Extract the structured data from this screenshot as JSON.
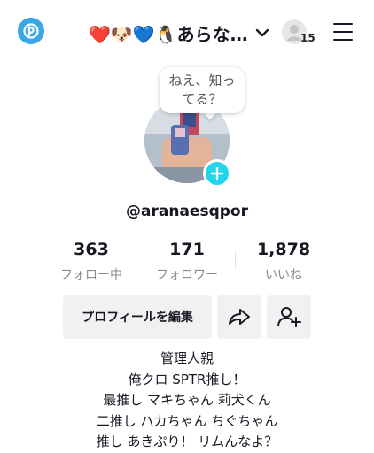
{
  "header": {
    "username": "❤️🐶💙🐧あらな…",
    "notification_count": "15"
  },
  "profile": {
    "bubble_text": "ねえ、知っ\nてる？",
    "handle": "@aranaesqpor"
  },
  "stats": [
    {
      "value": "363",
      "label": "フォロー中"
    },
    {
      "value": "171",
      "label": "フォロワー"
    },
    {
      "value": "1,878",
      "label": "いいね"
    }
  ],
  "actions": {
    "edit_profile_label": "プロフィールを編集"
  },
  "bio": [
    "管理人親",
    "俺クロ SPTR推し！",
    "最推し マキちゃん 莉犬くん",
    "二推し ハカちゃん ちぐちゃん",
    "推し あきぷり！ リムんなよ？"
  ],
  "colors": {
    "accent": "#20d5ec",
    "logo": "#3aa7e6",
    "button_bg": "#f1f1f2",
    "muted_text": "#8a8b91"
  }
}
